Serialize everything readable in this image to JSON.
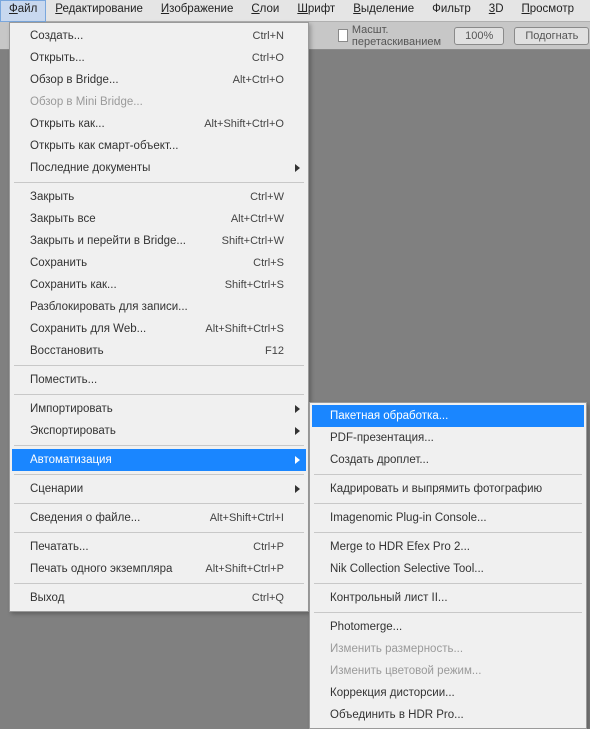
{
  "menubar": [
    {
      "label": "Файл",
      "u": 0
    },
    {
      "label": "Редактирование",
      "u": 0
    },
    {
      "label": "Изображение",
      "u": 0
    },
    {
      "label": "Слои",
      "u": 0
    },
    {
      "label": "Шрифт",
      "u": 0
    },
    {
      "label": "Выделение",
      "u": 0
    },
    {
      "label": "Фильтр",
      "u": -1
    },
    {
      "label": "3D",
      "u": 0
    },
    {
      "label": "Просмотр",
      "u": 0
    }
  ],
  "toolbar": {
    "drag_scale": "Масшт. перетаскиванием",
    "zoom": "100%",
    "fit": "Подогнать"
  },
  "file_menu": [
    {
      "label": "Создать...",
      "shortcut": "Ctrl+N"
    },
    {
      "label": "Открыть...",
      "shortcut": "Ctrl+O"
    },
    {
      "label": "Обзор в Bridge...",
      "shortcut": "Alt+Ctrl+O"
    },
    {
      "label": "Обзор в Mini Bridge...",
      "disabled": true
    },
    {
      "label": "Открыть как...",
      "shortcut": "Alt+Shift+Ctrl+O"
    },
    {
      "label": "Открыть как смарт-объект..."
    },
    {
      "label": "Последние документы",
      "submenu": true
    },
    {
      "sep": true
    },
    {
      "label": "Закрыть",
      "shortcut": "Ctrl+W"
    },
    {
      "label": "Закрыть все",
      "shortcut": "Alt+Ctrl+W"
    },
    {
      "label": "Закрыть и перейти в Bridge...",
      "shortcut": "Shift+Ctrl+W"
    },
    {
      "label": "Сохранить",
      "shortcut": "Ctrl+S"
    },
    {
      "label": "Сохранить как...",
      "shortcut": "Shift+Ctrl+S"
    },
    {
      "label": "Разблокировать для записи..."
    },
    {
      "label": "Сохранить для Web...",
      "shortcut": "Alt+Shift+Ctrl+S"
    },
    {
      "label": "Восстановить",
      "shortcut": "F12"
    },
    {
      "sep": true
    },
    {
      "label": "Поместить..."
    },
    {
      "sep": true
    },
    {
      "label": "Импортировать",
      "submenu": true
    },
    {
      "label": "Экспортировать",
      "submenu": true
    },
    {
      "sep": true
    },
    {
      "label": "Автоматизация",
      "submenu": true,
      "highlight": true
    },
    {
      "sep": true
    },
    {
      "label": "Сценарии",
      "submenu": true
    },
    {
      "sep": true
    },
    {
      "label": "Сведения о файле...",
      "shortcut": "Alt+Shift+Ctrl+I"
    },
    {
      "sep": true
    },
    {
      "label": "Печатать...",
      "shortcut": "Ctrl+P"
    },
    {
      "label": "Печать одного экземпляра",
      "shortcut": "Alt+Shift+Ctrl+P"
    },
    {
      "sep": true
    },
    {
      "label": "Выход",
      "shortcut": "Ctrl+Q"
    }
  ],
  "automation_submenu": [
    {
      "label": "Пакетная обработка...",
      "highlight": true
    },
    {
      "label": "PDF-презентация..."
    },
    {
      "label": "Создать дроплет..."
    },
    {
      "sep": true
    },
    {
      "label": "Кадрировать и выпрямить фотографию"
    },
    {
      "sep": true
    },
    {
      "label": "Imagenomic Plug-in Console..."
    },
    {
      "sep": true
    },
    {
      "label": "Merge to HDR Efex Pro 2..."
    },
    {
      "label": "Nik Collection Selective Tool..."
    },
    {
      "sep": true
    },
    {
      "label": "Контрольный лист II..."
    },
    {
      "sep": true
    },
    {
      "label": "Photomerge..."
    },
    {
      "label": "Изменить размерность...",
      "disabled": true
    },
    {
      "label": "Изменить цветовой режим...",
      "disabled": true
    },
    {
      "label": "Коррекция дисторсии..."
    },
    {
      "label": "Объединить в HDR Pro..."
    }
  ]
}
